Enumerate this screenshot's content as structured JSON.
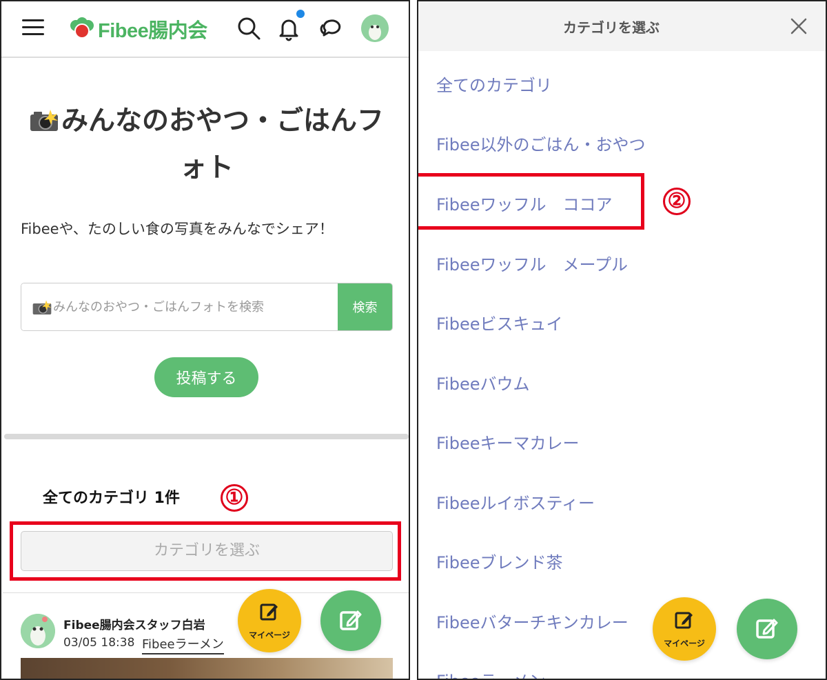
{
  "left": {
    "header": {
      "logo_text": "Fibee腸内会",
      "brand_color": "#4cb462",
      "icons": [
        "menu-icon",
        "search-icon",
        "bell-icon",
        "chat-icon",
        "avatar"
      ]
    },
    "title": "みんなのおやつ・ごはんフォト",
    "description": "Fibeeや、たのしい食の写真をみんなでシェア！",
    "search": {
      "placeholder": "みんなのおやつ・ごはんフォトを検索",
      "button_label": "検索"
    },
    "post_button_label": "投稿する",
    "category_count_label": "全てのカテゴリ 1件",
    "marker_1": "①",
    "category_select_label": "カテゴリを選ぶ",
    "post": {
      "user_name": "Fibee腸内会スタッフ白岩",
      "date": "03/05 18:38",
      "tag": "Fibeeラーメン"
    },
    "fab_mypage_label": "マイページ"
  },
  "right": {
    "modal_title": "カテゴリを選ぶ",
    "marker_2": "②",
    "categories": [
      "全てのカテゴリ",
      "Fibee以外のごはん・おやつ",
      "Fibeeワッフル　ココア",
      "Fibeeワッフル　メープル",
      "Fibeeビスキュイ",
      "Fibeeバウム",
      "Fibeeキーマカレー",
      "Fibeeルイボスティー",
      "Fibeeブレンド茶",
      "Fibeeバターチキンカレー",
      "Fibeeラーメン"
    ],
    "link_color": "#6f7bbd",
    "fab_mypage_label": "マイページ"
  },
  "colors": {
    "highlight_red": "#e8001c",
    "green": "#5ebd73",
    "yellow": "#f6bd16"
  }
}
